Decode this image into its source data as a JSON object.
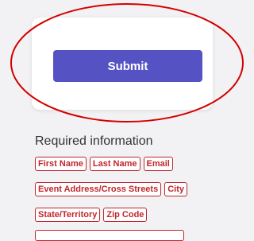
{
  "form": {
    "submit_label": "Submit"
  },
  "annotation": {
    "shape": "ellipse",
    "color": "#d40000"
  },
  "required_info": {
    "title": "Required information",
    "rows": [
      [
        "First Name",
        "Last Name",
        "Email"
      ],
      [
        "Event Address/Cross Streets",
        "City"
      ],
      [
        "State/Territory",
        "Zip Code"
      ]
    ]
  },
  "colors": {
    "accent": "#5553c3",
    "error": "#c0262d",
    "background": "#f2f2f4"
  }
}
